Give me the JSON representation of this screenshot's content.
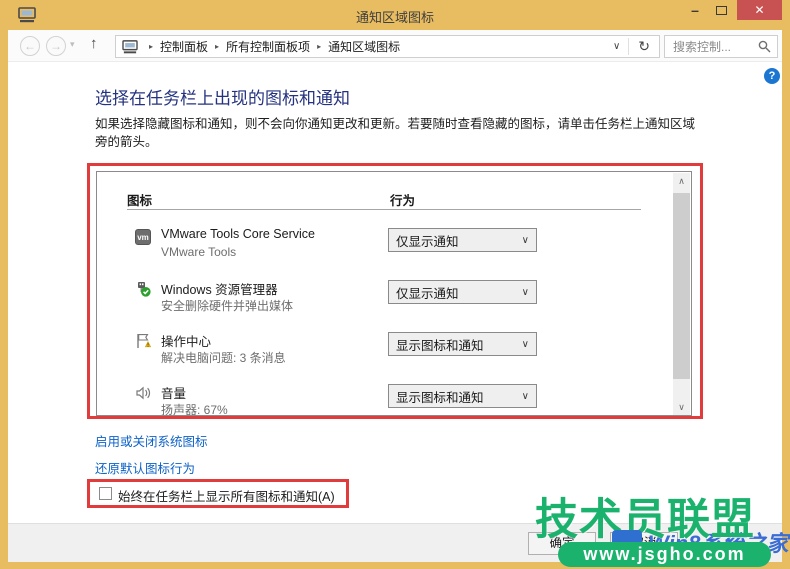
{
  "window": {
    "title": "通知区域图标",
    "controls": {
      "minimize_glyph": "–",
      "close_glyph": "✕"
    }
  },
  "toolbar": {
    "glyphs": {
      "back": "←",
      "forward": "→",
      "dropdown": "▾",
      "up": "↑",
      "crumb_sep": "▸",
      "chevron_down": "∨",
      "refresh": "↻"
    },
    "breadcrumb": [
      "控制面板",
      "所有控制面板项",
      "通知区域图标"
    ],
    "search_placeholder": "搜索控制..."
  },
  "page": {
    "heading": "选择在任务栏上出现的图标和通知",
    "description": "如果选择隐藏图标和通知，则不会向你通知更改和更新。若要随时查看隐藏的图标，请单击任务栏上通知区域旁的箭头。",
    "help_glyph": "?"
  },
  "list": {
    "columns": {
      "icon": "图标",
      "behavior": "行为"
    },
    "scrollbar": {
      "up_glyph": "∧",
      "down_glyph": "∨"
    },
    "rows": [
      {
        "icon": "vmware-icon",
        "icon_text": "vm",
        "title": "VMware Tools Core Service",
        "subtitle": "VMware Tools",
        "behavior": "仅显示通知"
      },
      {
        "icon": "safely-remove-hardware-icon",
        "title": "Windows 资源管理器",
        "subtitle": "安全删除硬件并弹出媒体",
        "behavior": "仅显示通知"
      },
      {
        "icon": "action-center-flag-icon",
        "title": "操作中心",
        "subtitle": "解决电脑问题: 3 条消息",
        "behavior": "显示图标和通知"
      },
      {
        "icon": "volume-speaker-icon",
        "title": "音量",
        "subtitle": "扬声器: 67%",
        "behavior": "显示图标和通知"
      }
    ]
  },
  "links": {
    "system_icons": "启用或关闭系统图标",
    "restore_defaults": "还原默认图标行为"
  },
  "checkbox": {
    "label": "始终在任务栏上显示所有图标和通知(A)",
    "checked": false
  },
  "footer": {
    "ok_label": "确定",
    "cancel_label": "取消"
  },
  "watermark": {
    "title": "技术员联盟",
    "url": "www.jsgho.com",
    "site": "Win8系统之家"
  },
  "colors": {
    "window_frame": "#e8bc60",
    "close_button": "#c85252",
    "annotation_red": "#e23b3b",
    "heading_blue": "#24327f",
    "link_blue": "#0d62c9",
    "watermark_green": "#1bb26d",
    "watermark_blue": "#3a6cd3"
  }
}
